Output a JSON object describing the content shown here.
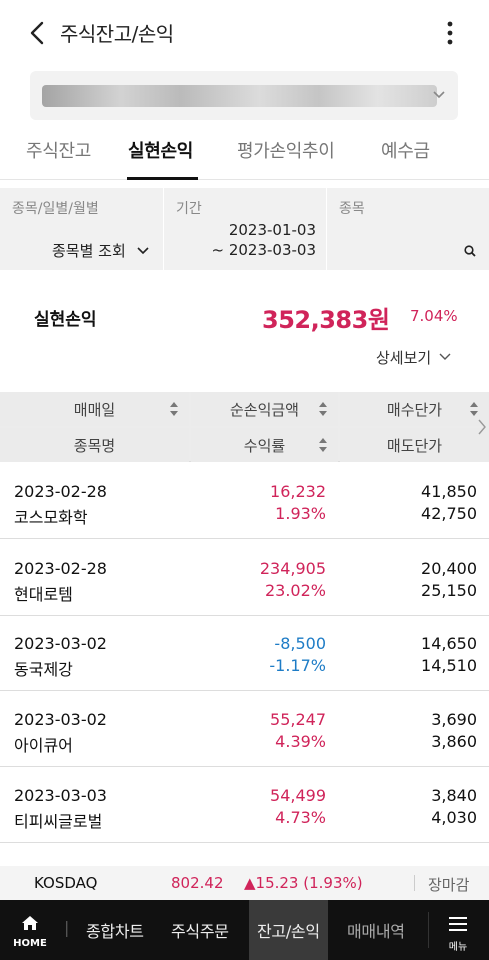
{
  "header": {
    "title": "주식잔고/손익"
  },
  "tabs": [
    {
      "label": "주식잔고",
      "active": false
    },
    {
      "label": "실현손익",
      "active": true
    },
    {
      "label": "평가손익추이",
      "active": false
    },
    {
      "label": "예수금",
      "active": false
    }
  ],
  "filter": {
    "view_label": "종목/일별/월별",
    "view_value": "종목별 조회",
    "period_label": "기간",
    "period_start": "2023-01-03",
    "period_end": "~ 2023-03-03",
    "stock_label": "종목"
  },
  "summary": {
    "label": "실현손익",
    "amount": "352,383원",
    "rate": "7.04%",
    "detail_label": "상세보기"
  },
  "table": {
    "headers_row1": [
      "매매일",
      "순손익금액",
      "매수단가"
    ],
    "headers_row2": [
      "종목명",
      "수익률",
      "매도단가"
    ],
    "rows": [
      {
        "date": "2023-02-28",
        "name": "코스모화학",
        "profit": "16,232",
        "rate": "1.93%",
        "buy": "41,850",
        "sell": "42,750",
        "sign": "pos"
      },
      {
        "date": "2023-02-28",
        "name": "현대로템",
        "profit": "234,905",
        "rate": "23.02%",
        "buy": "20,400",
        "sell": "25,150",
        "sign": "pos"
      },
      {
        "date": "2023-03-02",
        "name": "동국제강",
        "profit": "-8,500",
        "rate": "-1.17%",
        "buy": "14,650",
        "sell": "14,510",
        "sign": "neg"
      },
      {
        "date": "2023-03-02",
        "name": "아이큐어",
        "profit": "55,247",
        "rate": "4.39%",
        "buy": "3,690",
        "sell": "3,860",
        "sign": "pos"
      },
      {
        "date": "2023-03-03",
        "name": "티피씨글로벌",
        "profit": "54,499",
        "rate": "4.73%",
        "buy": "3,840",
        "sell": "4,030",
        "sign": "pos"
      }
    ]
  },
  "ticker": {
    "name": "KOSDAQ",
    "value": "802.42",
    "change": "▲15.23 (1.93%)",
    "status": "장마감"
  },
  "bottom_nav": {
    "home": "HOME",
    "cut_item": "|",
    "items": [
      "종합차트",
      "주식주문",
      "잔고/손익",
      "매매내역"
    ],
    "menu": "메뉴"
  },
  "colors": {
    "positive": "#d0245a",
    "negative": "#1e7cc6",
    "nav_bg": "#111111"
  },
  "icons": [
    "back-arrow-icon",
    "more-vertical-icon",
    "chevron-down-icon",
    "search-icon",
    "sort-icon",
    "chevron-right-icon",
    "home-icon",
    "menu-icon"
  ]
}
